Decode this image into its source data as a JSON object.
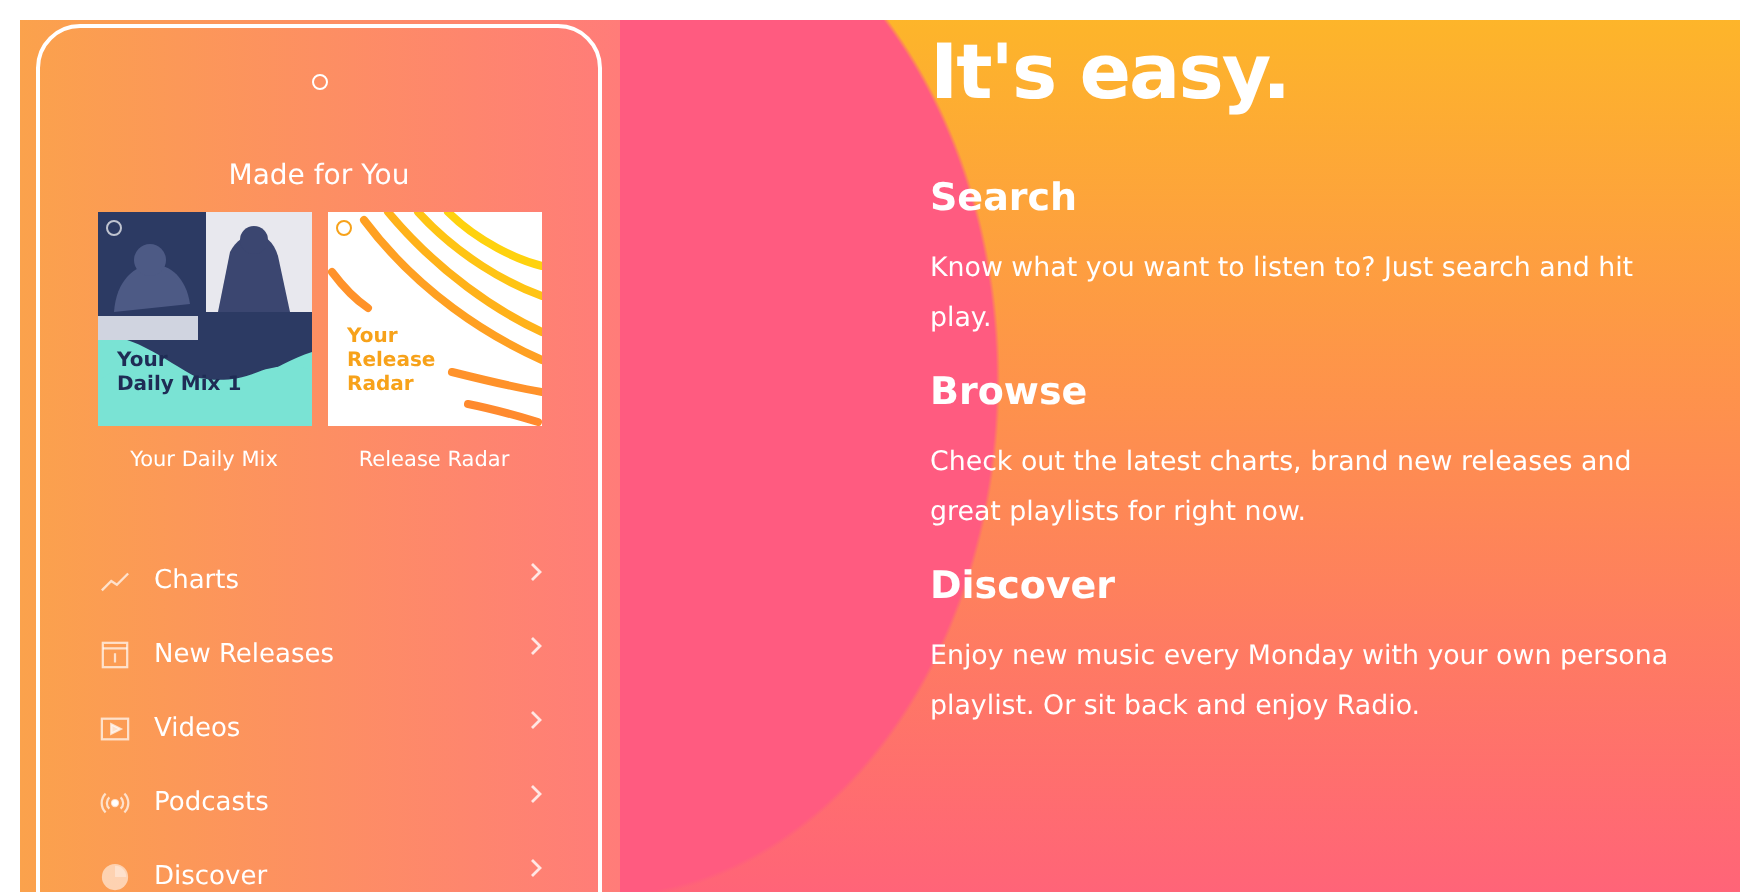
{
  "phone": {
    "section_title": "Made for You",
    "playlists": [
      {
        "kind": "mix",
        "cover_lines": [
          "Your",
          "Daily Mix 1"
        ],
        "caption": "Your Daily Mix"
      },
      {
        "kind": "radar",
        "cover_lines": [
          "Your",
          "Release",
          "Radar"
        ],
        "caption": "Release Radar"
      }
    ],
    "menu": [
      {
        "kind": "charts",
        "label": "Charts"
      },
      {
        "kind": "releases",
        "label": "New Releases"
      },
      {
        "kind": "videos",
        "label": "Videos"
      },
      {
        "kind": "podcasts",
        "label": "Podcasts"
      },
      {
        "kind": "discover",
        "label": "Discover"
      }
    ]
  },
  "headline": "It's easy.",
  "features": [
    {
      "title": "Search",
      "lines": [
        "Know what you want to listen to? Just search and hit",
        "play."
      ]
    },
    {
      "title": "Browse",
      "lines": [
        "Check out the latest charts, brand new releases and",
        "great playlists for right now."
      ]
    },
    {
      "title": "Discover",
      "lines": [
        "Enjoy new music every Monday with your own persona",
        "playlist. Or sit back and enjoy Radio."
      ]
    }
  ]
}
